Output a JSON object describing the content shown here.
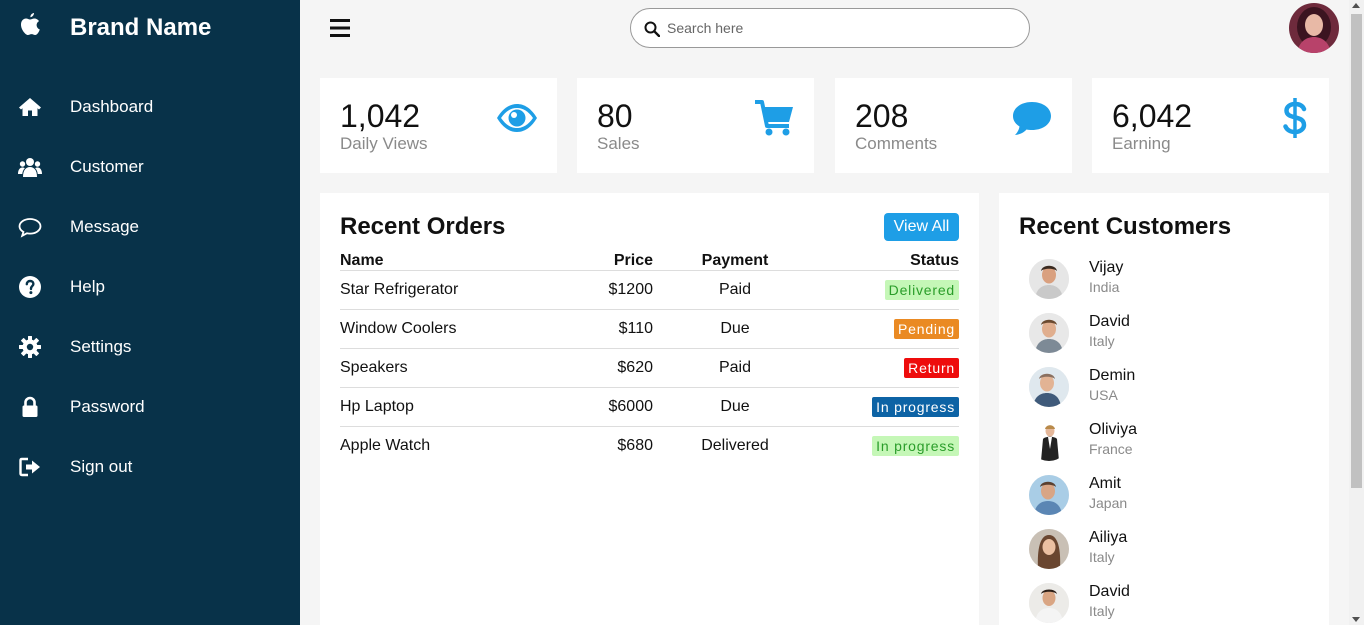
{
  "colors": {
    "sidebar_bg": "#083249",
    "accent": "#1e9ee6",
    "page_bg": "#f5f5f5"
  },
  "sidebar": {
    "brand": "Brand Name",
    "brand_icon": "apple-icon",
    "items": [
      {
        "label": "Dashboard",
        "icon": "home-icon"
      },
      {
        "label": "Customer",
        "icon": "users-icon"
      },
      {
        "label": "Message",
        "icon": "chat-icon"
      },
      {
        "label": "Help",
        "icon": "help-icon"
      },
      {
        "label": "Settings",
        "icon": "gear-icon"
      },
      {
        "label": "Password",
        "icon": "lock-icon"
      },
      {
        "label": "Sign out",
        "icon": "sign-out-icon"
      }
    ]
  },
  "topbar": {
    "search_placeholder": "Search here"
  },
  "cards": [
    {
      "value": "1,042",
      "label": "Daily Views",
      "icon": "eye-icon"
    },
    {
      "value": "80",
      "label": "Sales",
      "icon": "cart-icon"
    },
    {
      "value": "208",
      "label": "Comments",
      "icon": "comment-icon"
    },
    {
      "value": "6,042",
      "label": "Earning",
      "icon": "dollar-icon"
    }
  ],
  "orders": {
    "title": "Recent Orders",
    "view_all": "View All",
    "headers": {
      "name": "Name",
      "price": "Price",
      "payment": "Payment",
      "status": "Status"
    },
    "rows": [
      {
        "name": "Star Refrigerator",
        "price": "$1200",
        "payment": "Paid",
        "status": "Delivered",
        "badge_bg": "#c5f7b7",
        "badge_fg": "#2a9d2a"
      },
      {
        "name": "Window Coolers",
        "price": "$110",
        "payment": "Due",
        "status": "Pending",
        "badge_bg": "#ea8a23",
        "badge_fg": "#ffffff"
      },
      {
        "name": "Speakers",
        "price": "$620",
        "payment": "Paid",
        "status": "Return",
        "badge_bg": "#ee0c0c",
        "badge_fg": "#ffffff"
      },
      {
        "name": "Hp Laptop",
        "price": "$6000",
        "payment": "Due",
        "status": "In progress",
        "badge_bg": "#0d63a5",
        "badge_fg": "#ffffff"
      },
      {
        "name": "Apple Watch",
        "price": "$680",
        "payment": "Delivered",
        "status": "In progress",
        "badge_bg": "#c5f7b7",
        "badge_fg": "#2a9d2a"
      }
    ]
  },
  "customers": {
    "title": "Recent Customers",
    "list": [
      {
        "name": "Vijay",
        "country": "India"
      },
      {
        "name": "David",
        "country": "Italy"
      },
      {
        "name": "Demin",
        "country": "USA"
      },
      {
        "name": "Oliviya",
        "country": "France"
      },
      {
        "name": "Amit",
        "country": "Japan"
      },
      {
        "name": "Ailiya",
        "country": "Italy"
      },
      {
        "name": "David",
        "country": "Italy"
      }
    ]
  }
}
